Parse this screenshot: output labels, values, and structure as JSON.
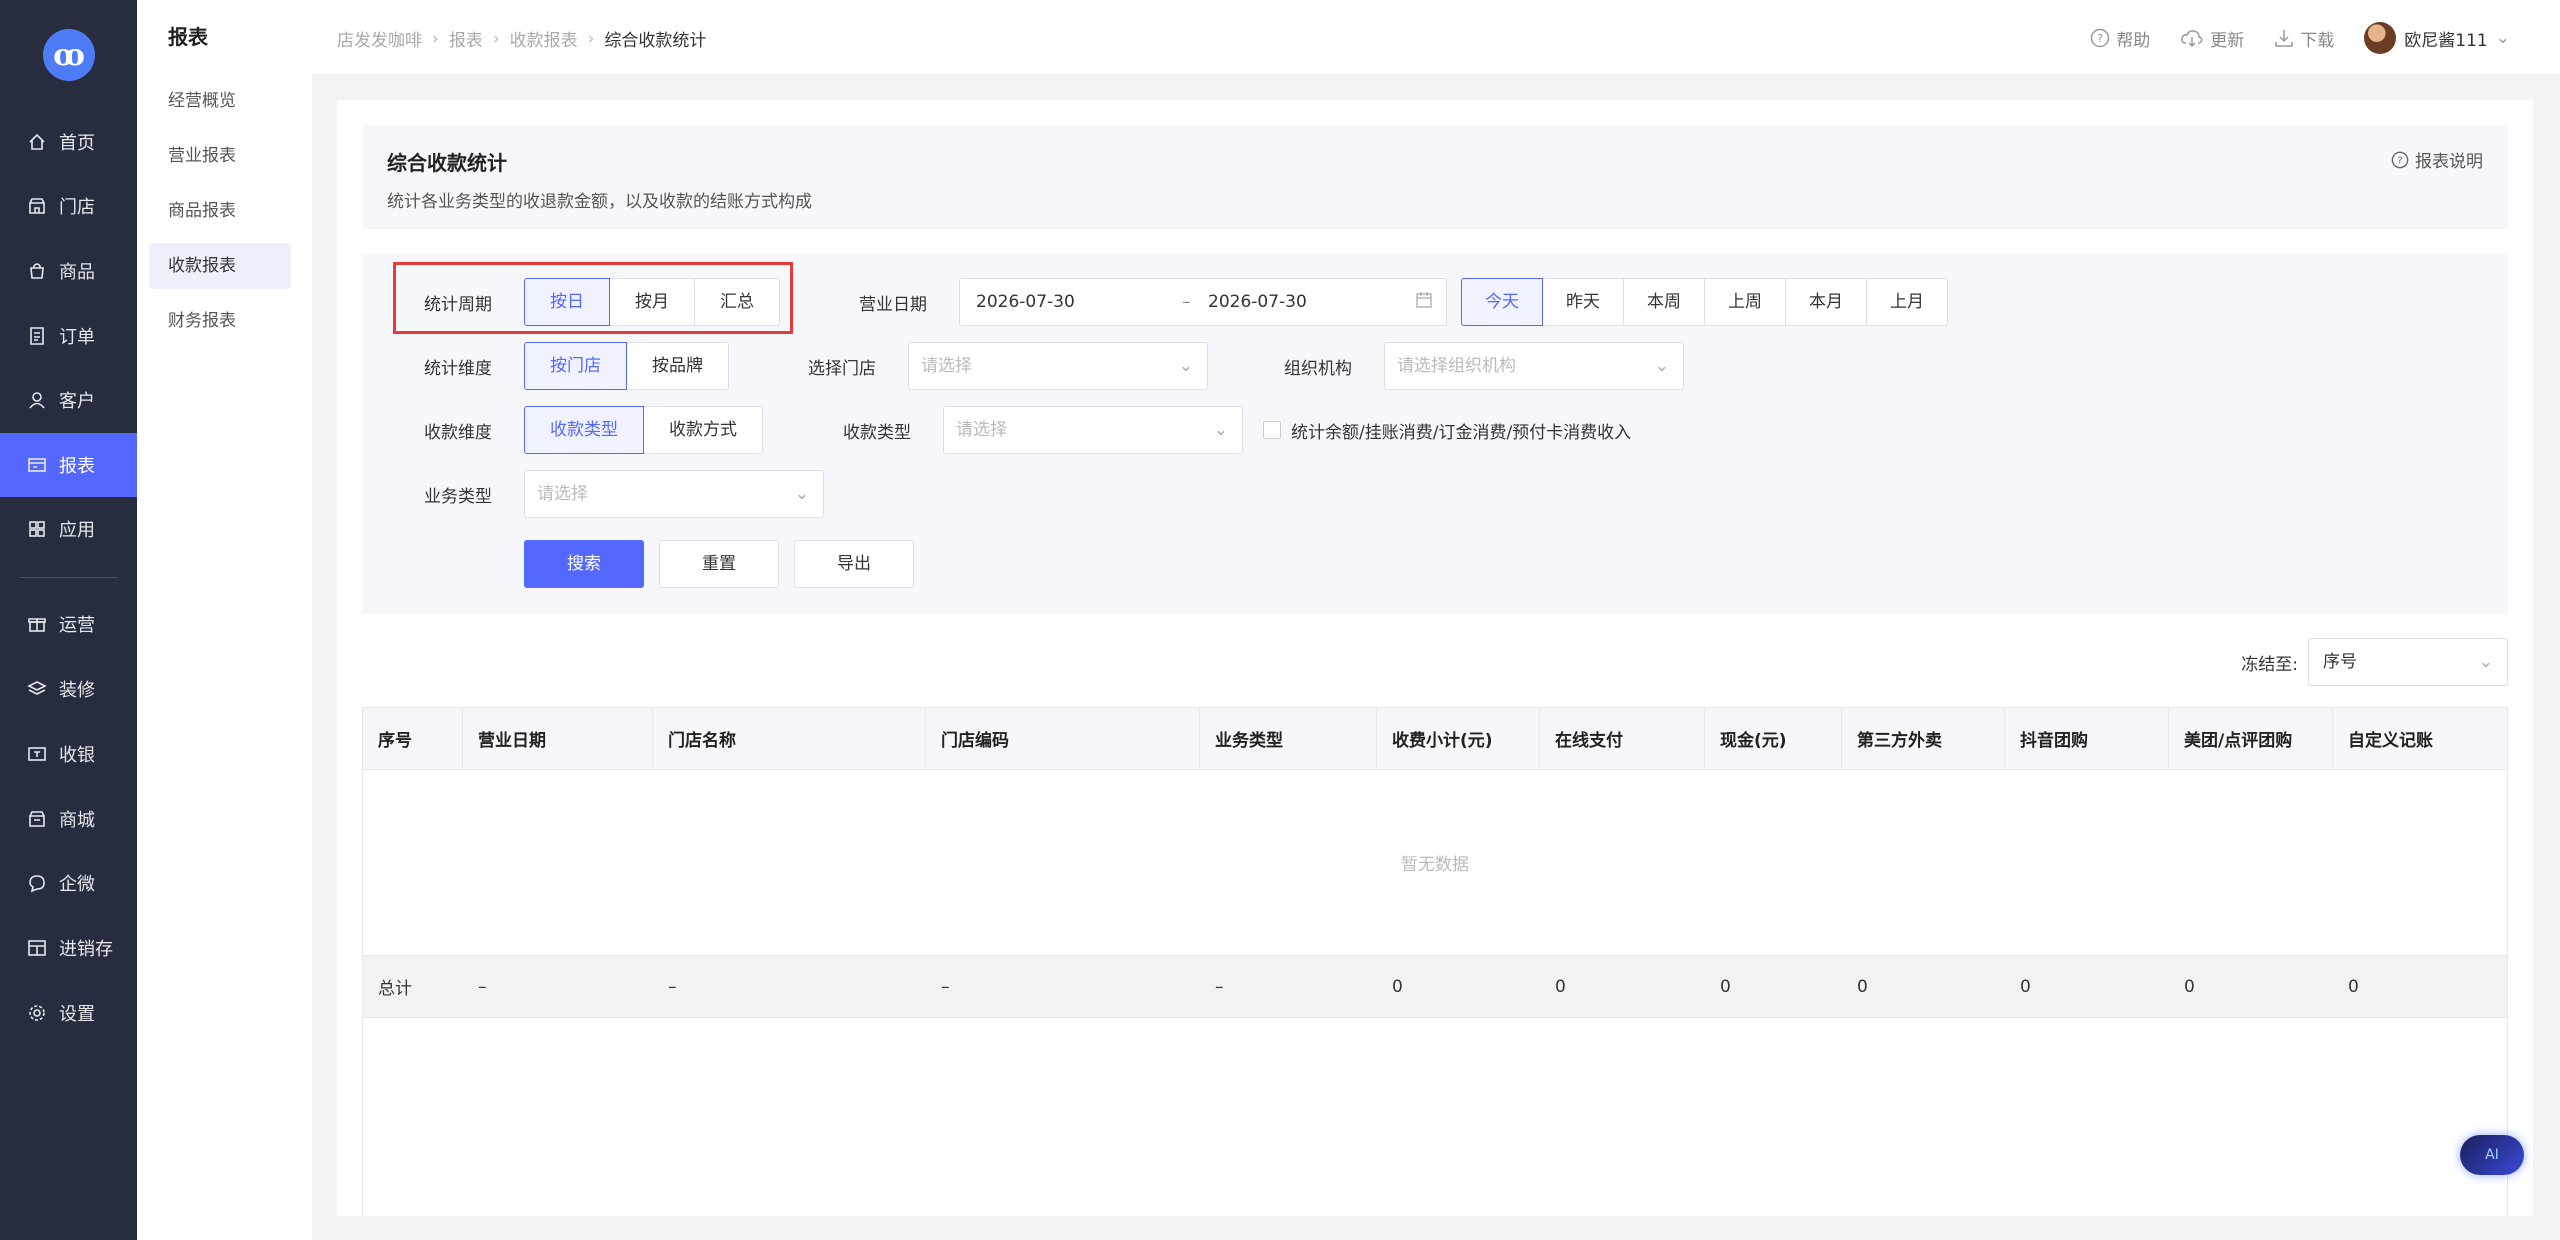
{
  "nav": {
    "logo": "ꝏ",
    "items": [
      {
        "label": "首页",
        "icon": "home-icon"
      },
      {
        "label": "门店",
        "icon": "store-icon"
      },
      {
        "label": "商品",
        "icon": "bag-icon"
      },
      {
        "label": "订单",
        "icon": "order-icon"
      },
      {
        "label": "客户",
        "icon": "user-icon"
      },
      {
        "label": "报表",
        "icon": "report-icon"
      },
      {
        "label": "应用",
        "icon": "apps-icon"
      },
      {
        "label": "运营",
        "icon": "gift-icon"
      },
      {
        "label": "装修",
        "icon": "layers-icon"
      },
      {
        "label": "收银",
        "icon": "cashier-icon"
      },
      {
        "label": "商城",
        "icon": "mall-icon"
      },
      {
        "label": "企微",
        "icon": "chat-icon"
      },
      {
        "label": "进销存",
        "icon": "inventory-icon"
      },
      {
        "label": "设置",
        "icon": "gear-icon"
      }
    ]
  },
  "submenu": {
    "title": "报表",
    "items": [
      "经营概览",
      "营业报表",
      "商品报表",
      "收款报表",
      "财务报表"
    ]
  },
  "header": {
    "breadcrumbs": [
      "店发发咖啡",
      "报表",
      "收款报表",
      "综合收款统计"
    ],
    "help": "帮助",
    "update": "更新",
    "download": "下载",
    "user": "欧尼酱111"
  },
  "intro": {
    "title": "综合收款统计",
    "desc": "统计各业务类型的收退款金额，以及收款的结账方式构成",
    "help": "报表说明"
  },
  "filters": {
    "period_label": "统计周期",
    "period_options": [
      "按日",
      "按月",
      "汇总"
    ],
    "biz_date_label": "营业日期",
    "date_start": "2026-07-30",
    "date_sep": "–",
    "date_end": "2026-07-30",
    "quick_dates": [
      "今天",
      "昨天",
      "本周",
      "上周",
      "本月",
      "上月"
    ],
    "dimension_label": "统计维度",
    "dimension_options": [
      "按门店",
      "按品牌"
    ],
    "store_label": "选择门店",
    "store_placeholder": "请选择",
    "org_label": "组织机构",
    "org_placeholder": "请选择组织机构",
    "pay_dim_label": "收款维度",
    "pay_dim_options": [
      "收款类型",
      "收款方式"
    ],
    "pay_type_label": "收款类型",
    "pay_type_placeholder": "请选择",
    "checkbox_label": "统计余额/挂账消费/订金消费/预付卡消费收入",
    "biz_type_label": "业务类型",
    "biz_type_placeholder": "请选择",
    "search": "搜索",
    "reset": "重置",
    "export": "导出"
  },
  "freeze": {
    "label": "冻结至:",
    "value": "序号"
  },
  "table": {
    "columns": [
      "序号",
      "营业日期",
      "门店名称",
      "门店编码",
      "业务类型",
      "收费小计(元)",
      "在线支付",
      "现金(元)",
      "第三方外卖",
      "抖音团购",
      "美团/点评团购",
      "自定义记账"
    ],
    "empty": "暂无数据",
    "total": [
      "总计",
      "–",
      "–",
      "–",
      "–",
      "0",
      "0",
      "0",
      "0",
      "0",
      "0",
      "0"
    ]
  },
  "assistant": "AI"
}
